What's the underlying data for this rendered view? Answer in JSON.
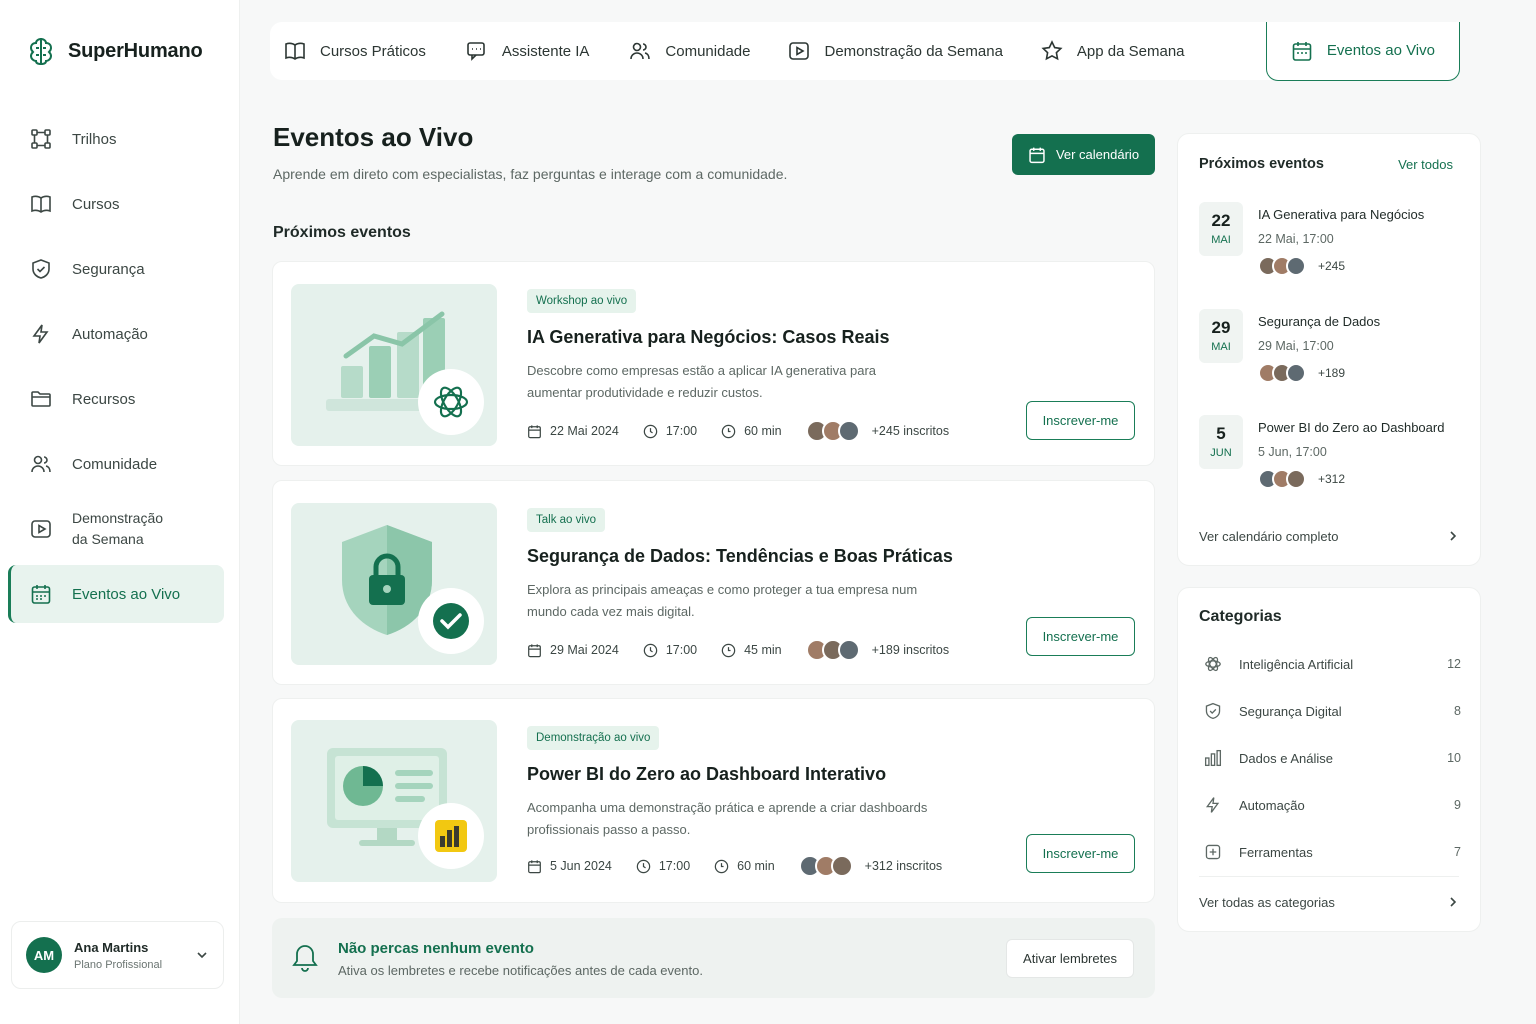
{
  "brand": {
    "name": "SuperHumano"
  },
  "sidebar": {
    "items": [
      {
        "label": "Trilhos",
        "icon": "route-icon"
      },
      {
        "label": "Cursos",
        "icon": "book-icon"
      },
      {
        "label": "Segurança",
        "icon": "shield-icon"
      },
      {
        "label": "Automação",
        "icon": "bolt-icon"
      },
      {
        "label": "Recursos",
        "icon": "folder-icon"
      },
      {
        "label": "Comunidade",
        "icon": "users-icon"
      },
      {
        "label": "Demonstração da Semana",
        "icon": "play-icon"
      },
      {
        "label": "Eventos ao Vivo",
        "icon": "calendar-icon",
        "active": true
      }
    ]
  },
  "user": {
    "initials": "AM",
    "name": "Ana Martins",
    "plan": "Plano Profissional"
  },
  "tabs": [
    {
      "label": "Cursos Práticos",
      "icon": "book-icon"
    },
    {
      "label": "Assistente IA",
      "icon": "chat-icon"
    },
    {
      "label": "Comunidade",
      "icon": "users-icon"
    },
    {
      "label": "Demonstração da Semana",
      "icon": "play-icon"
    },
    {
      "label": "App da Semana",
      "icon": "star-icon"
    },
    {
      "label": "Eventos ao Vivo",
      "icon": "calendar-icon",
      "active": true
    }
  ],
  "header": {
    "title": "Eventos ao Vivo",
    "subtitle": "Aprende em direto com especialistas, faz perguntas e interage com a comunidade.",
    "calendar_button": "Ver calendário"
  },
  "main": {
    "section_title": "Próximos eventos",
    "events": [
      {
        "badge": "Workshop ao vivo",
        "title": "IA Generativa para Negócios: Casos Reais",
        "description": "Descobre como empresas estão a aplicar IA generativa para aumentar produtividade e reduzir custos.",
        "date": "22 Mai 2024",
        "time": "17:00",
        "duration": "60 min",
        "attendees": "+245 inscritos",
        "button": "Inscrever-me",
        "thumbnail": "chart-openai-icon"
      },
      {
        "badge": "Talk ao vivo",
        "title": "Segurança de Dados: Tendências e Boas Práticas",
        "description": "Explora as principais ameaças e como proteger a tua empresa num mundo cada vez mais digital.",
        "date": "29 Mai 2024",
        "time": "17:00",
        "duration": "45 min",
        "attendees": "+189 inscritos",
        "button": "Inscrever-me",
        "thumbnail": "shield-lock-icon"
      },
      {
        "badge": "Demonstração ao vivo",
        "title": "Power BI do Zero ao Dashboard Interativo",
        "description": "Acompanha uma demonstração prática e aprende a criar dashboards profissionais passo a passo.",
        "date": "5 Jun 2024",
        "time": "17:00",
        "duration": "60 min",
        "attendees": "+312 inscritos",
        "button": "Inscrever-me",
        "thumbnail": "monitor-powerbi-icon"
      }
    ]
  },
  "reminder": {
    "title": "Não percas nenhum evento",
    "subtitle": "Ativa os lembretes e recebe notificações antes de cada evento.",
    "button": "Ativar lembretes"
  },
  "upcoming_panel": {
    "title": "Próximos eventos",
    "link": "Ver todos",
    "items": [
      {
        "day": "22",
        "month": "MAI",
        "title": "IA Generativa para Negócios",
        "datetime": "22 Mai, 17:00",
        "count": "+245"
      },
      {
        "day": "29",
        "month": "MAI",
        "title": "Segurança de Dados",
        "datetime": "29 Mai, 17:00",
        "count": "+189"
      },
      {
        "day": "5",
        "month": "JUN",
        "title": "Power BI do Zero ao Dashboard",
        "datetime": "5 Jun, 17:00",
        "count": "+312"
      }
    ],
    "footer": "Ver calendário completo"
  },
  "categories_panel": {
    "title": "Categorias",
    "items": [
      {
        "name": "Inteligência Artificial",
        "count": "12",
        "icon": "openai-icon"
      },
      {
        "name": "Segurança Digital",
        "count": "8",
        "icon": "shield-icon"
      },
      {
        "name": "Dados e Análise",
        "count": "10",
        "icon": "bar-chart-icon"
      },
      {
        "name": "Automação",
        "count": "9",
        "icon": "bolt-icon"
      },
      {
        "name": "Ferramentas",
        "count": "7",
        "icon": "tools-icon"
      }
    ],
    "footer": "Ver todas as categorias"
  },
  "colors": {
    "accent": "#14704f",
    "accent_light": "#e6f3ec",
    "background": "#f7f8f8"
  }
}
